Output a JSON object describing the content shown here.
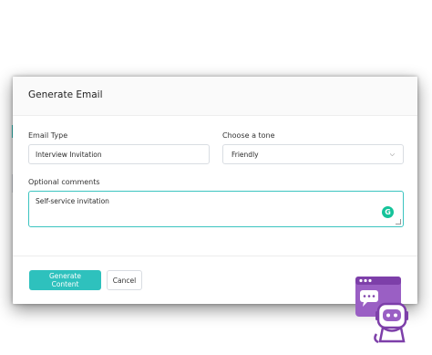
{
  "modal": {
    "title": "Generate Email",
    "email_type": {
      "label": "Email Type",
      "value": "Interview Invitation"
    },
    "tone": {
      "label": "Choose a tone",
      "selected": "Friendly"
    },
    "comments": {
      "label": "Optional comments",
      "value": "Self-service invitation"
    },
    "buttons": {
      "generate": "Generate Content",
      "cancel": "Cancel"
    }
  },
  "icons": {
    "grammarly": "grammarly-icon",
    "chevron": "chevron-down-icon",
    "bot": "chat-bot-icon"
  },
  "colors": {
    "accent": "#2ec1bd",
    "bot_purple": "#8a4fb3"
  }
}
